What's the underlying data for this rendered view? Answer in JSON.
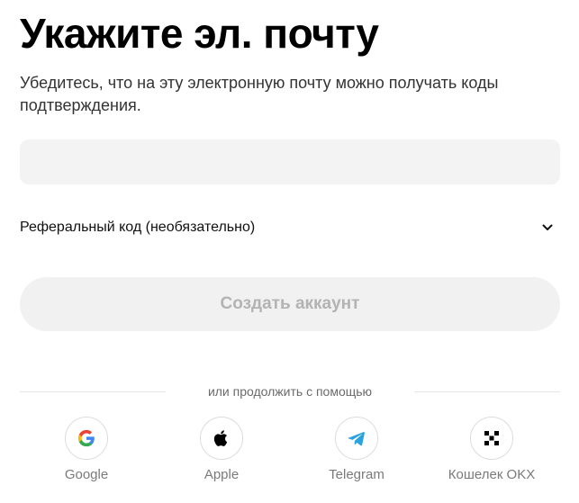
{
  "header": {
    "title": "Укажите эл. почту",
    "subtitle": "Убедитесь, что на эту электронную почту можно получать коды подтверждения."
  },
  "form": {
    "email_value": "",
    "email_placeholder": "",
    "referral_label": "Реферальный код (необязательно)",
    "submit_label": "Создать аккаунт"
  },
  "alt_login": {
    "divider_text": "или продолжить с помощью",
    "providers": [
      {
        "label": "Google",
        "icon": "google-icon"
      },
      {
        "label": "Apple",
        "icon": "apple-icon"
      },
      {
        "label": "Telegram",
        "icon": "telegram-icon"
      },
      {
        "label": "Кошелек OKX",
        "icon": "okx-icon"
      }
    ]
  },
  "colors": {
    "button_bg": "#f1f1f1",
    "button_text": "#b3b3b3",
    "input_bg": "#f3f3f3",
    "telegram": "#2aa3e0"
  }
}
